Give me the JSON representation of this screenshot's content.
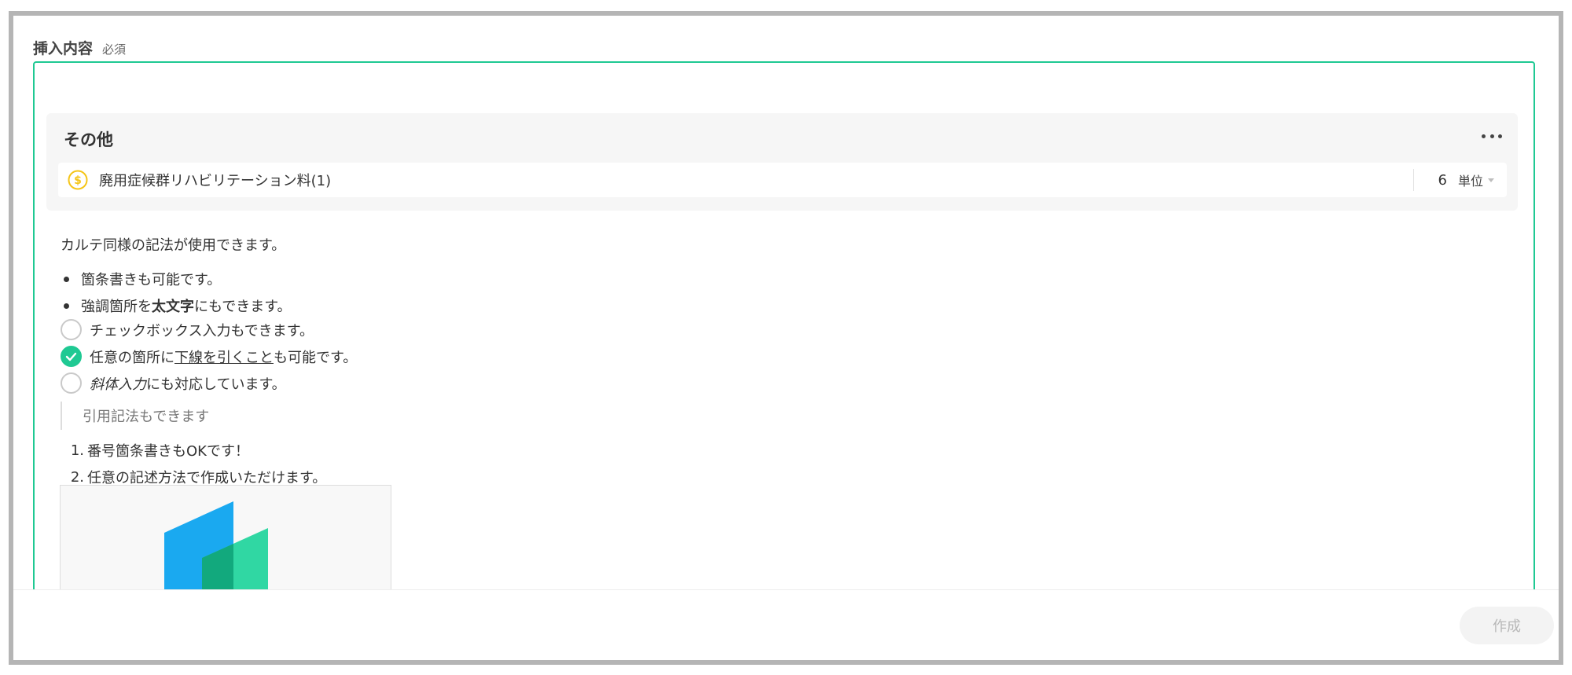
{
  "field": {
    "label": "挿入内容",
    "required": "必須"
  },
  "block": {
    "title": "その他",
    "fee": {
      "name": "廃用症候群リハビリテーション料(1)",
      "quantity": "6",
      "unit": "単位"
    }
  },
  "content": {
    "intro": "カルテ同様の記法が使用できます。",
    "bullet1": "箇条書きも可能です。",
    "bullet2": {
      "before": "強調箇所を",
      "bold": "太文字",
      "after": "にもできます。"
    },
    "check1": {
      "checked": false,
      "text": "チェックボックス入力もできます。"
    },
    "check2": {
      "checked": true,
      "before": "任意の箇所に",
      "underline": "下線を引くこと",
      "after": "も可能です。"
    },
    "check3": {
      "checked": false,
      "italic": "斜体入力",
      "after": "にも対応しています。"
    },
    "quote": "引用記法もできます",
    "ordered": [
      {
        "num": "1.",
        "text": "番号箇条書きもOKです！"
      },
      {
        "num": "2.",
        "text": "任意の記述方法で作成いただけます。"
      }
    ]
  },
  "footer": {
    "create_label": "作成"
  },
  "colors": {
    "accent": "#1fc993",
    "coin": "#f5c518",
    "logo_blue": "#1aa9f0",
    "logo_green": "#1ed49b"
  }
}
